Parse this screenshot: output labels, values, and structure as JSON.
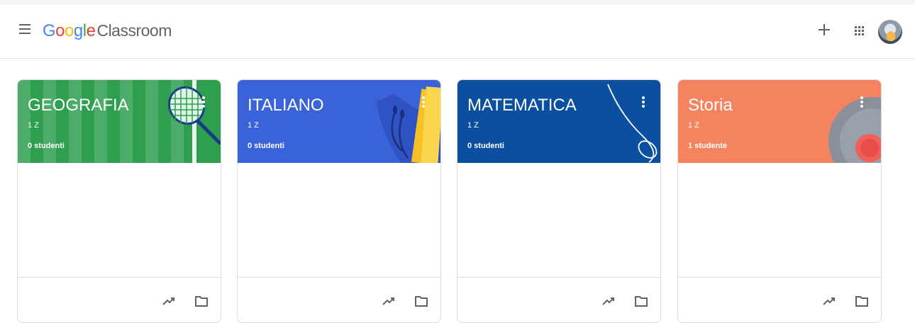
{
  "app": {
    "logo_letters": [
      "G",
      "o",
      "o",
      "g",
      "l",
      "e"
    ],
    "product": "Classroom"
  },
  "colors": {
    "geografia": "#2e9e4f",
    "italiano": "#3b63d9",
    "matematica": "#0b4fa0",
    "storia": "#f4845f"
  },
  "cards": [
    {
      "title": "GEOGRAFIA",
      "section": "1 Z",
      "students": "0 studenti",
      "illustration": "tennis-racket-icon"
    },
    {
      "title": "ITALIANO",
      "section": "1 Z",
      "students": "0 studenti",
      "illustration": "books-headphones-icon"
    },
    {
      "title": "MATEMATICA",
      "section": "1 Z",
      "students": "0 studenti",
      "illustration": "string-loop-icon"
    },
    {
      "title": "Storia",
      "section": "1 Z",
      "students": "1 studente",
      "illustration": "vinyl-record-icon"
    }
  ]
}
